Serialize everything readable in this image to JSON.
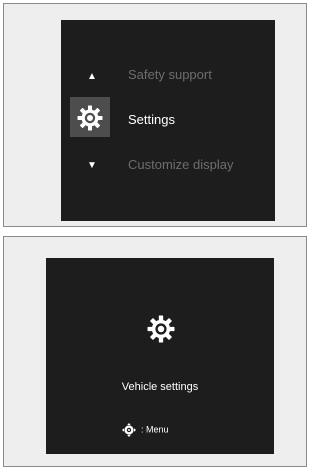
{
  "menu": {
    "items": [
      {
        "label": "Safety support",
        "state": "inactive"
      },
      {
        "label": "Settings",
        "state": "selected",
        "icon": "gear-icon"
      },
      {
        "label": "Customize display",
        "state": "inactive"
      }
    ],
    "nav_icons": [
      "arrow-up-icon",
      "arrow-down-icon"
    ]
  },
  "detail": {
    "icon": "gear-icon",
    "title": "Vehicle settings",
    "hint_icon": "dial-icon",
    "hint_label": ": Menu"
  },
  "colors": {
    "screen_bg": "#1d1d1d",
    "selected_text": "#ffffff",
    "inactive_text": "#6d6d6d",
    "selection_highlight": "#4d4d4d"
  }
}
